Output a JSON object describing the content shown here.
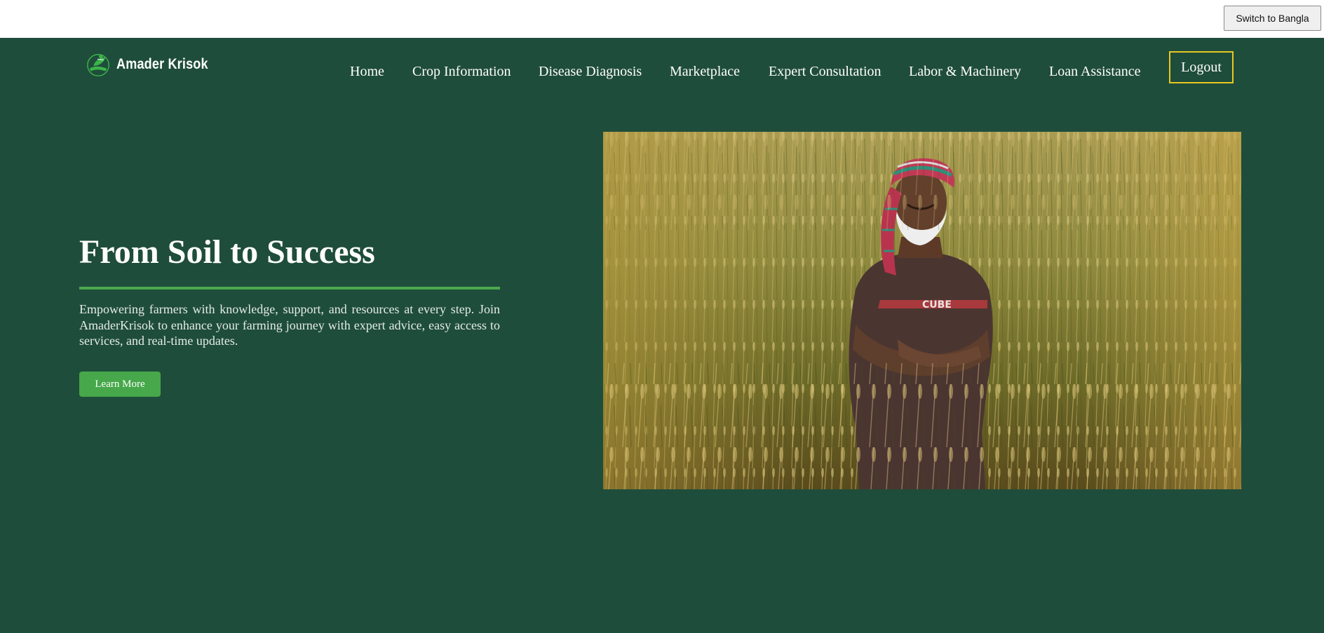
{
  "topbar": {
    "language_button": "Switch to Bangla"
  },
  "brand": {
    "name": "Amader Krisok",
    "icon": "farmer-hand-leaf-icon",
    "color": "#3cb44a"
  },
  "nav": {
    "items": [
      {
        "label": "Home"
      },
      {
        "label": "Crop Information"
      },
      {
        "label": "Disease Diagnosis"
      },
      {
        "label": "Marketplace"
      },
      {
        "label": "Expert Consultation"
      },
      {
        "label": "Labor & Machinery"
      },
      {
        "label": "Loan Assistance"
      }
    ],
    "logout_label": "Logout"
  },
  "hero": {
    "title": "From Soil to Success",
    "description": "Empowering farmers with knowledge, support, and resources at every step. Join AmaderKrisok to enhance your farming journey with expert advice, easy access to services, and real-time updates.",
    "cta_label": "Learn More",
    "image": {
      "subject": "farmer-in-wheat-field-photo",
      "shirt_text": "CUBE"
    }
  },
  "colors": {
    "background": "#1f4d3b",
    "accent_green": "#46a84a",
    "logout_border": "#e8c722",
    "text": "#ffffff"
  }
}
